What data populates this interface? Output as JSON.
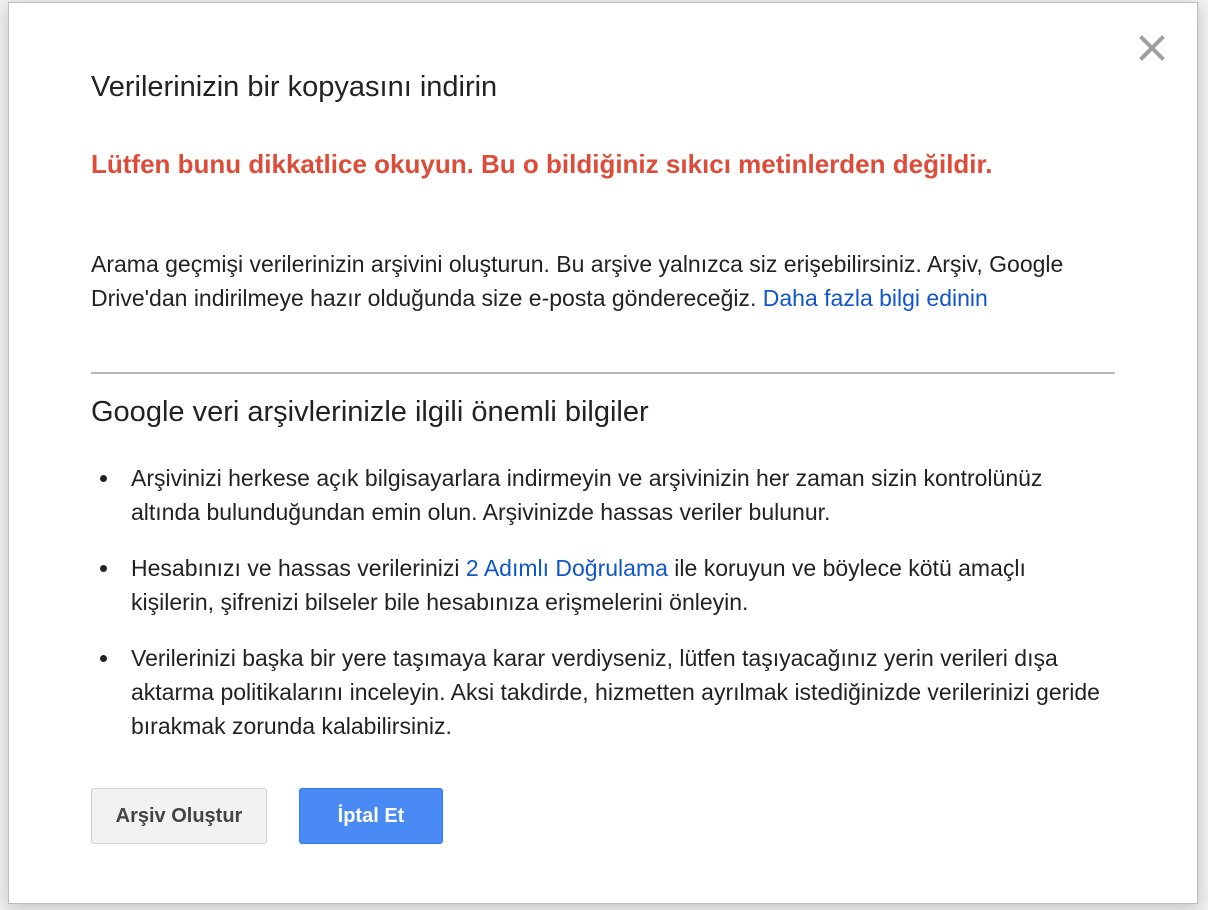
{
  "dialog": {
    "title": "Verilerinizin bir kopyasını indirin",
    "warning": "Lütfen bunu dikkatlice okuyun. Bu o bildiğiniz sıkıcı metinlerden değildir.",
    "intro_text": "Arama geçmişi verilerinizin arşivini oluşturun. Bu arşive yalnızca siz erişebilirsiniz. Arşiv, Google Drive'dan indirilmeye hazır olduğunda size e-posta göndereceğiz. ",
    "learn_more_link": "Daha fazla bilgi edinin",
    "close_icon": "close-icon"
  },
  "info_section": {
    "title": "Google veri arşivlerinizle ilgili önemli bilgiler",
    "items": [
      {
        "text": "Arşivinizi herkese açık bilgisayarlara indirmeyin ve arşivinizin her zaman sizin kontrolünüz altında bulunduğundan emin olun. Arşivinizde hassas veriler bulunur."
      },
      {
        "text_before": "Hesabınızı ve hassas verilerinizi ",
        "link": "2 Adımlı Doğrulama",
        "text_after": " ile koruyun ve böylece kötü amaçlı kişilerin, şifrenizi bilseler bile hesabınıza erişmelerini önleyin."
      },
      {
        "text": "Verilerinizi başka bir yere taşımaya karar verdiyseniz, lütfen taşıyacağınız yerin verileri dışa aktarma politikalarını inceleyin. Aksi takdirde, hizmetten ayrılmak istediğinizde verilerinizi geride bırakmak zorunda kalabilirsiniz."
      }
    ]
  },
  "buttons": {
    "create_archive": "Arşiv Oluştur",
    "cancel": "İptal Et"
  },
  "colors": {
    "warning": "#dd4b39",
    "link": "#1155cc",
    "primary_button": "#4a8af4"
  }
}
